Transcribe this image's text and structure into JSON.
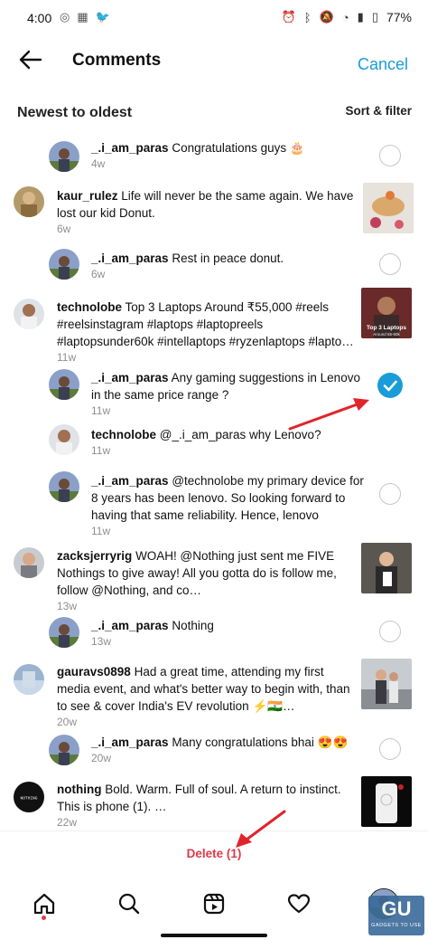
{
  "status_bar": {
    "time": "4:00",
    "battery": "77%"
  },
  "header": {
    "title": "Comments",
    "cancel": "Cancel"
  },
  "subheader": {
    "sort_title": "Newest to oldest",
    "sort_filter": "Sort & filter"
  },
  "comments": [
    {
      "user": "_.i_am_paras",
      "text": " Congratulations guys 🎂",
      "time": "4w"
    },
    {
      "user": "kaur_rulez",
      "text": " Life will never be the same again. We have lost our kid Donut.",
      "time": "6w"
    },
    {
      "user": "_.i_am_paras",
      "text": " Rest in peace donut.",
      "time": "6w"
    },
    {
      "user": "technolobe",
      "text": " Top 3 Laptops Around ₹55,000 #reels #reelsinstagram #laptops #laptopreels #laptopsunder60k #intellaptops #ryzenlaptops #lapto…",
      "time": "11w"
    },
    {
      "user": "_.i_am_paras",
      "text": " Any gaming suggestions in Lenovo in the same price range ?",
      "time": "11w"
    },
    {
      "user": "technolobe",
      "text": " @_.i_am_paras why Lenovo?",
      "time": "11w"
    },
    {
      "user": "_.i_am_paras",
      "text": " @technolobe my primary device for 8 years has been lenovo. So looking forward to having that same reliability. Hence, lenovo",
      "time": "11w"
    },
    {
      "user": "zacksjerryrig",
      "text": " WOAH! @Nothing just sent me FIVE Nothings to give away! All you gotta do is follow me, follow @Nothing, and co…",
      "time": "13w"
    },
    {
      "user": "_.i_am_paras",
      "text": " Nothing",
      "time": "13w"
    },
    {
      "user": "gauravs0898",
      "text": " Had a great time, attending my first media event, and what's better way to begin with, than to see & cover India's EV revolution ⚡🇮🇳…",
      "time": "20w"
    },
    {
      "user": "_.i_am_paras",
      "text": " Many congratulations bhai 😍😍",
      "time": "20w"
    },
    {
      "user": "nothing",
      "text": " Bold. Warm. Full of soul. A return to instinct. This is phone (1). …",
      "time": "22w"
    }
  ],
  "thumb_texts": {
    "laptops_title": "Top 3 Laptops",
    "laptops_sub": "Around 55-60k"
  },
  "avatar_texts": {
    "nothing": "NOTHING"
  },
  "footer": {
    "delete_label": "Delete (1)"
  },
  "watermark": {
    "logo": "GU",
    "caption": "GADGETS TO USE"
  },
  "colors": {
    "accent": "#1a9cd8",
    "delete": "#e0394a",
    "annotation_arrow": "#e0242b"
  }
}
